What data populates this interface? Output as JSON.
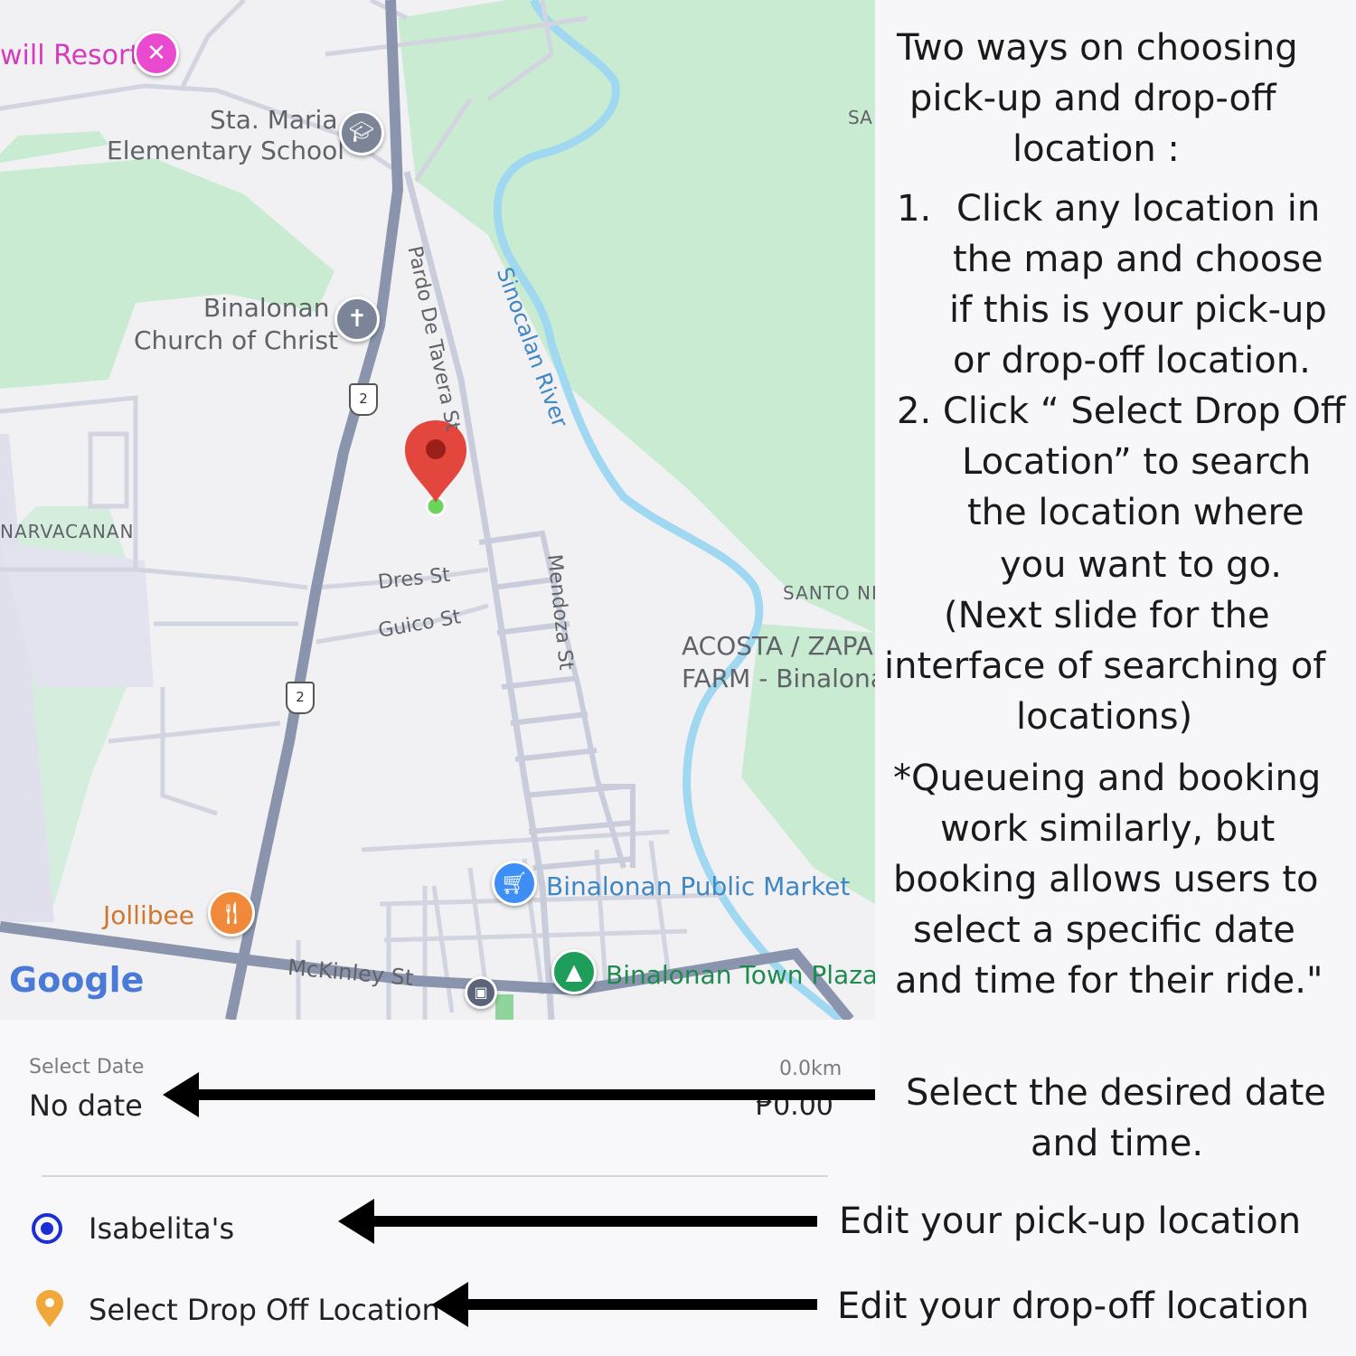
{
  "map": {
    "labels": {
      "resort": "will Resort",
      "school_line1": "Sta. Maria",
      "school_line2": "Elementary School",
      "church_line1": "Binalonan",
      "church_line2": "Church of Christ",
      "narvacanan": "NARVACANAN",
      "pardo": "Pardo De Tavera St",
      "sinocalan": "Sinocalan River",
      "mendoza": "Mendoza St",
      "dres": "Dres St",
      "guico": "Guico St",
      "santo": "SANTO NI",
      "sa": "SA",
      "acosta_line1": "ACOSTA / ZAPAN",
      "acosta_line2": "FARM - Binalona",
      "market": "Binalonan Public Market",
      "plaza": "Binalonan Town Plaza",
      "jollibee": "Jollibee",
      "mckinley": "McKinley St",
      "route_a": "2",
      "route_b": "2",
      "google": "Google"
    },
    "colors": {
      "green": "#c9ebd2",
      "road": "#8a95ad",
      "water": "#9fd8f0",
      "pin": "#e2463d"
    }
  },
  "booking": {
    "date_label": "Select Date",
    "date_value": "No date",
    "distance": "0.0km",
    "price": "₱0.00",
    "pickup": "Isabelita's",
    "dropoff": "Select Drop Off Location"
  },
  "instructions": {
    "intro_line1": "Two ways on choosing",
    "intro_line2": "pick-up and drop-off",
    "intro_line3": "location :",
    "step1_num": "1.",
    "step1_line1": "Click any location in",
    "step1_line2": "the map and choose",
    "step1_line3": "if this is your pick-up",
    "step1_line4": "or drop-off location.",
    "step2_line1": "2. Click “ Select Drop Off",
    "step2_line2": "Location” to search",
    "step2_line3": "the location where",
    "step2_line4": "you want to go.",
    "next_line1": "(Next slide for the",
    "next_line2": "interface of searching of",
    "next_line3": "locations)",
    "note_line1": "*Queueing and booking",
    "note_line2": "work similarly, but",
    "note_line3": "booking allows users to",
    "note_line4": "select a specific date",
    "note_line5": "and time for their ride.\"",
    "date_line1": "Select the desired date",
    "date_line2": "and time.",
    "pickup_note": "Edit your pick-up location",
    "dropoff_note": "Edit your drop-off location"
  }
}
